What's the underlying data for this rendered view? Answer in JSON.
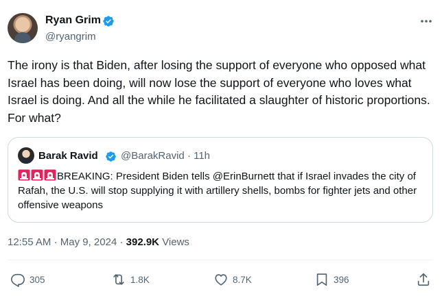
{
  "author": {
    "name": "Ryan Grim",
    "handle": "@ryangrim"
  },
  "tweet": {
    "text": "The irony is that Biden, after losing the support of everyone who opposed what Israel has been doing, will now lose the support of everyone who loves what Israel is doing. And all the while he facilitated a slaughter of historic proportions. For what?"
  },
  "quote": {
    "name": "Barak Ravid",
    "handle": "@BarakRavid",
    "separator": "·",
    "time": "11h",
    "text": "BREAKING: President Biden tells @ErinBurnett that if Israel invades the city of Rafah, the U.S. will stop supplying it with artillery shells, bombs for fighter jets and other offensive weapons"
  },
  "meta": {
    "time": "12:55 AM",
    "separator": "·",
    "date": "May 9, 2024",
    "views_count": "392.9K",
    "views_label": "Views"
  },
  "actions": {
    "reply_count": "305",
    "repost_count": "1.8K",
    "like_count": "8.7K",
    "bookmark_count": "396"
  },
  "colors": {
    "text_primary": "#0f1419",
    "text_secondary": "#536471",
    "verified_blue": "#1d9bf0",
    "border": "#cfd9de",
    "siren_red": "#e0245e"
  },
  "icons": [
    "verified-badge-icon",
    "more-icon",
    "siren-icon",
    "reply-icon",
    "repost-icon",
    "like-icon",
    "bookmark-icon",
    "share-icon"
  ]
}
